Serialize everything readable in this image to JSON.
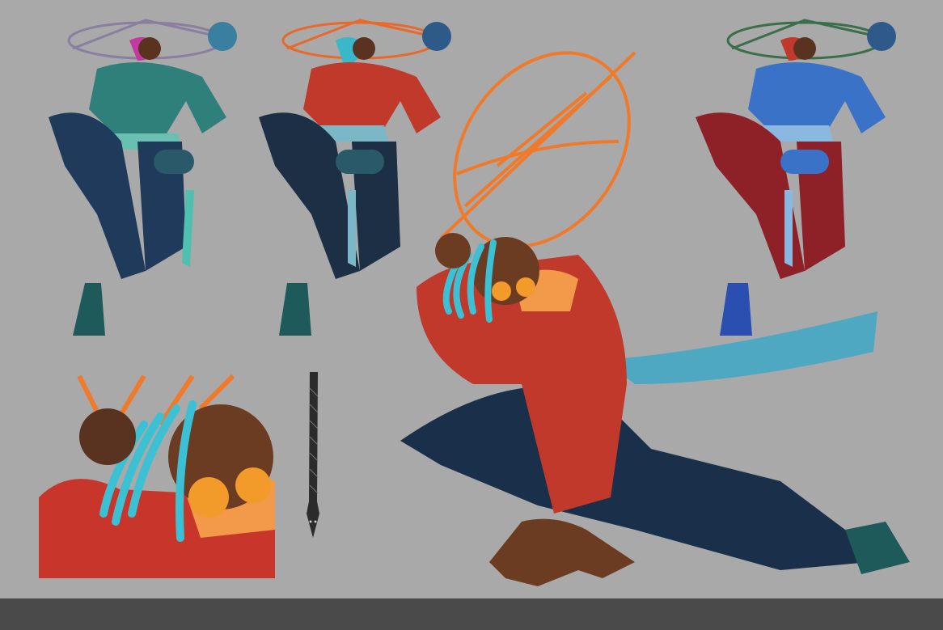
{
  "artboard": {
    "background": "#a9a9a9",
    "bottom_bar_color": "#4a4a4a"
  },
  "figures": [
    {
      "name": "variant-teal",
      "outfit": "#2f7f7a",
      "pants": "#1f3a5a",
      "hair": "#c23aa0",
      "hat": "#8a7fa0"
    },
    {
      "name": "variant-red",
      "outfit": "#c0392b",
      "pants": "#1d2f44",
      "hair": "#3ab7c8",
      "hat": "#e8692a"
    },
    {
      "name": "variant-blue",
      "outfit": "#3a72c8",
      "pants": "#8e2028",
      "hair": "#c0392b",
      "hat": "#3b6f4a"
    }
  ],
  "main_figure": {
    "jacket": "#c0392b",
    "pants": "#1a2f4a",
    "hair": "#3cc0d4",
    "hat": "#f07a2a",
    "sash": "#4fa8c2",
    "skin": "#6b3b22"
  },
  "detail_crop": {
    "jacket": "#c8362b",
    "hair": "#3cc0d4",
    "glasses": "#f29a2a"
  },
  "snake": {
    "body": "#2b2b2b"
  }
}
